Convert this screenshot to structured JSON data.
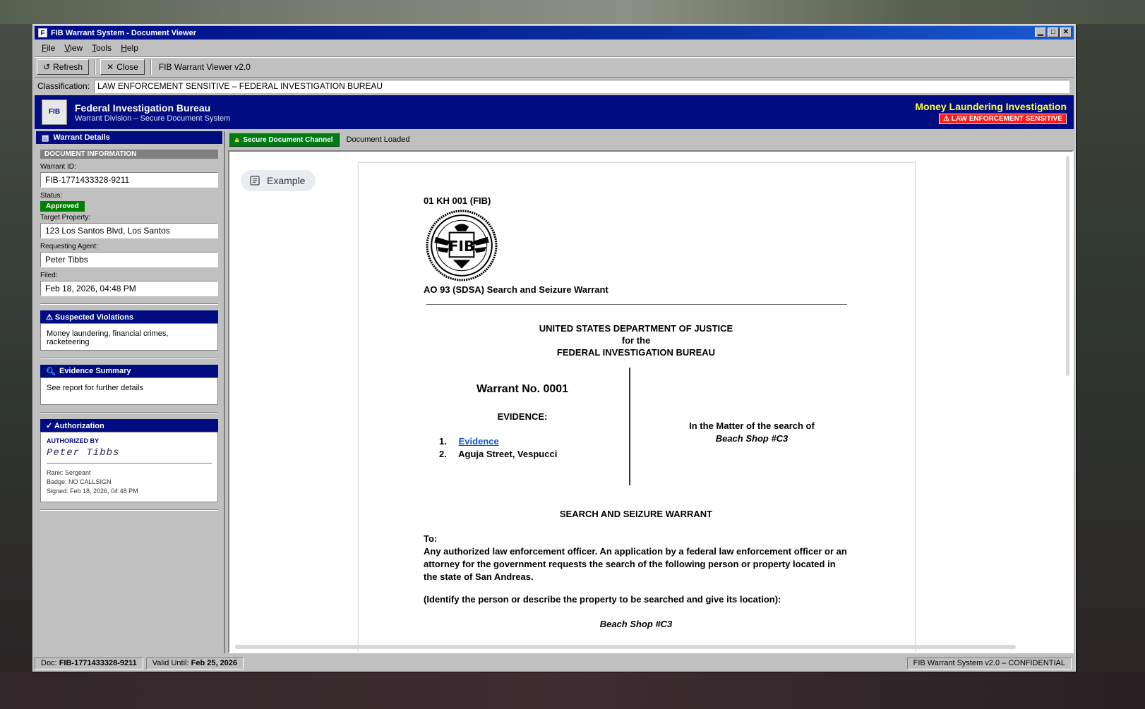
{
  "window": {
    "title": "FIB Warrant System - Document Viewer",
    "controls": [
      "minimize-icon",
      "maximize-icon",
      "close-icon"
    ]
  },
  "menu": [
    "File",
    "View",
    "Tools",
    "Help"
  ],
  "toolbar": {
    "refresh_label": "Refresh",
    "refresh_icon": "↺",
    "close_label": "Close",
    "close_icon": "✕",
    "app_version": "FIB Warrant Viewer v2.0"
  },
  "classification": {
    "label": "Classification:",
    "value": "LAW ENFORCEMENT SENSITIVE – FEDERAL INVESTIGATION BUREAU"
  },
  "banner": {
    "logo_text": "FIB",
    "title": "Federal Investigation Bureau",
    "subtitle": "Warrant Division – Secure Document System",
    "case_title": "Money Laundering Investigation",
    "badge": "⚠ LAW ENFORCEMENT SENSITIVE",
    "colors": {
      "bar": "#000c80",
      "case_title": "#ffff33",
      "badge": "#ff1a1a"
    }
  },
  "sidebar": {
    "header": "Warrant Details",
    "section": "DOCUMENT INFORMATION",
    "fields": {
      "warrant_id_label": "Warrant ID:",
      "warrant_id": "FIB-1771433328-9211",
      "status_label": "Status:",
      "status": "Approved",
      "target_label": "Target Property:",
      "target": "123 Los Santos Blvd, Los Santos",
      "agent_label": "Requesting Agent:",
      "agent": "Peter Tibbs",
      "filed_label": "Filed:",
      "filed": "Feb 18, 2026, 04:48 PM"
    },
    "violations": {
      "header": "⚠ Suspected Violations",
      "text": "Money laundering, financial crimes, racketeering"
    },
    "evidence": {
      "header": "Evidence Summary",
      "text": "See report for further details"
    },
    "authorization": {
      "header": "✓ Authorization",
      "label": "AUTHORIZED BY",
      "signature": "Peter Tibbs",
      "rank": "Rank: Sergeant",
      "badge": "Badge: NO CALLSIGN",
      "signed": "Signed: Feb 18, 2026, 04:48 PM"
    }
  },
  "strip": {
    "secure_label": "Secure Document Channel",
    "loaded_label": "Document Loaded",
    "secure_color": "#007a14"
  },
  "document": {
    "chip_label": "Example",
    "code": "01 KH 001 (FIB)",
    "seal_text": "FIB",
    "form": "AO 93 (SDSA) Search and Seizure Warrant",
    "dept_line1": "UNITED STATES DEPARTMENT OF JUSTICE",
    "dept_line2": "for the",
    "dept_line3": "FEDERAL INVESTIGATION BUREAU",
    "warrant_no": "Warrant No. 0001",
    "evidence_heading": "EVIDENCE:",
    "evidence_items": [
      {
        "num": "1.",
        "text": "Evidence",
        "link": true
      },
      {
        "num": "2.",
        "text": "Aguja Street, Vespucci",
        "link": false
      }
    ],
    "matter_line": "In the Matter of the search of",
    "matter_subject": "Beach Shop #C3",
    "ssw_heading": "SEARCH AND SEIZURE WARRANT",
    "to_label": "To:",
    "to_text": "Any authorized law enforcement officer. An application by a federal law enforcement officer or an attorney for the government requests the search of the following person or property located in the state of San Andreas.",
    "identify_text": "(Identify the person or describe the property to be searched and give its location):",
    "cut_text": "Beach Shop #C3"
  },
  "statusbar": {
    "doc_label": "Doc:",
    "doc_value": "FIB-1771433328-9211",
    "valid_label": "Valid Until:",
    "valid_value": "Feb 25, 2026",
    "system": "FIB Warrant System v2.0 – CONFIDENTIAL"
  }
}
